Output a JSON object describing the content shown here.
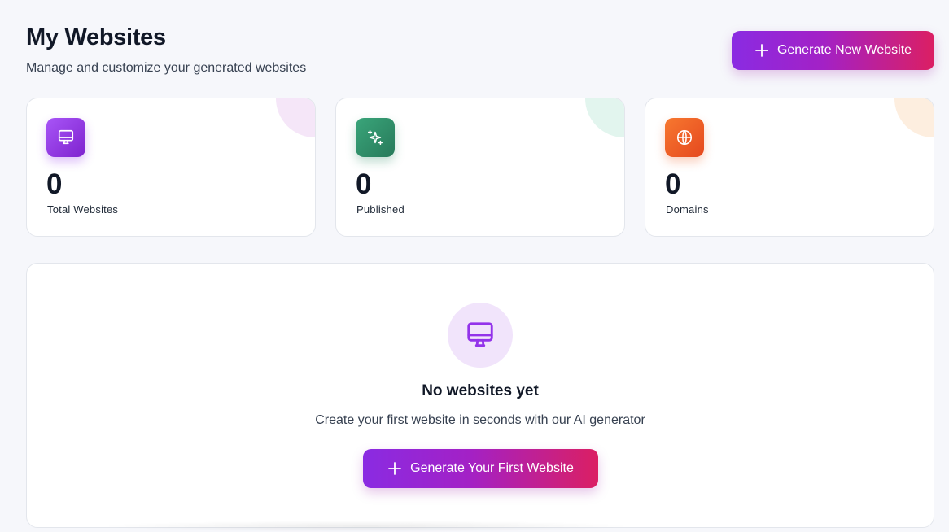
{
  "header": {
    "title": "My Websites",
    "subtitle": "Manage and customize your generated websites",
    "generate_button_label": "Generate New Website"
  },
  "stats": [
    {
      "icon": "monitor-icon",
      "value": "0",
      "label": "Total Websites",
      "color": "#9333ea"
    },
    {
      "icon": "sparkles-icon",
      "value": "0",
      "label": "Published",
      "color": "#2f8f68"
    },
    {
      "icon": "globe-icon",
      "value": "0",
      "label": "Domains",
      "color": "#f0642a"
    }
  ],
  "empty_state": {
    "icon": "monitor-icon",
    "title": "No websites yet",
    "description": "Create your first website in seconds with our AI generator",
    "button_label": "Generate Your First Website"
  },
  "colors": {
    "accent_start": "#8a2be2",
    "accent_end": "#db1f63",
    "background": "#f6f7fb"
  }
}
